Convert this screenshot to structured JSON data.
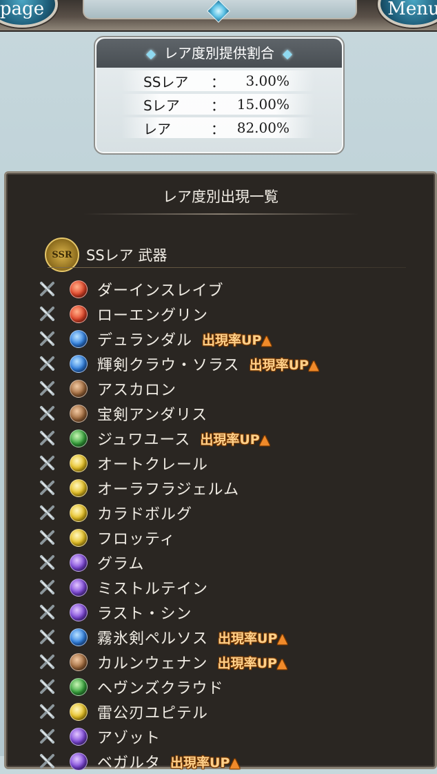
{
  "nav": {
    "left_label": "page",
    "right_label": "Menu"
  },
  "rates": {
    "title": "レア度別提供割合",
    "rows": [
      {
        "rarity": "SSレア",
        "sep": "：",
        "value": "3.00%"
      },
      {
        "rarity": "Sレア",
        "sep": "：",
        "value": "15.00%"
      },
      {
        "rarity": "レア",
        "sep": "：",
        "value": "82.00%"
      }
    ]
  },
  "panel": {
    "title": "レア度別出現一覧",
    "section": {
      "badge": "SSR",
      "title": "SSレア 武器"
    },
    "rate_up_label": "出現率UP",
    "items": [
      {
        "name": "ダーインスレイブ",
        "element": "fire-icon",
        "rate_up": false
      },
      {
        "name": "ローエングリン",
        "element": "fire-icon",
        "rate_up": false
      },
      {
        "name": "デュランダル",
        "element": "water-icon",
        "rate_up": true
      },
      {
        "name": "輝剣クラウ・ソラス",
        "element": "water-icon",
        "rate_up": true
      },
      {
        "name": "アスカロン",
        "element": "earth-icon",
        "rate_up": false
      },
      {
        "name": "宝剣アンダリス",
        "element": "earth-icon",
        "rate_up": false
      },
      {
        "name": "ジュワユース",
        "element": "wind-icon",
        "rate_up": true
      },
      {
        "name": "オートクレール",
        "element": "light-icon",
        "rate_up": false
      },
      {
        "name": "オーラフラジェルム",
        "element": "light-icon",
        "rate_up": false
      },
      {
        "name": "カラドボルグ",
        "element": "light-icon",
        "rate_up": false
      },
      {
        "name": "フロッティ",
        "element": "light-icon",
        "rate_up": false
      },
      {
        "name": "グラム",
        "element": "dark-icon",
        "rate_up": false
      },
      {
        "name": "ミストルテイン",
        "element": "dark-icon",
        "rate_up": false
      },
      {
        "name": "ラスト・シン",
        "element": "dark-icon",
        "rate_up": false
      },
      {
        "name": "霧氷剣ペルソス",
        "element": "water-icon",
        "rate_up": true
      },
      {
        "name": "カルンウェナン",
        "element": "earth-icon",
        "rate_up": true
      },
      {
        "name": "ヘヴンズクラウド",
        "element": "wind-icon",
        "rate_up": false
      },
      {
        "name": "雷公刃ユピテル",
        "element": "light-icon",
        "rate_up": false
      },
      {
        "name": "アゾット",
        "element": "dark-icon",
        "rate_up": false
      },
      {
        "name": "ベガルタ",
        "element": "dark-icon",
        "rate_up": true
      }
    ]
  }
}
